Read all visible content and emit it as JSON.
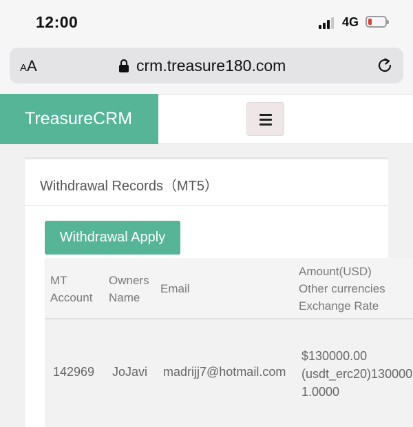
{
  "status_bar": {
    "time": "12:00",
    "network": "4G"
  },
  "browser": {
    "text_size_label_small": "A",
    "text_size_label_large": "A",
    "url": "crm.treasure180.com"
  },
  "app": {
    "brand": "TreasureCRM"
  },
  "page": {
    "title": "Withdrawal Records（MT5）",
    "apply_button": "Withdrawal Apply"
  },
  "table": {
    "headers": {
      "mt_account": [
        "MT",
        "Account"
      ],
      "owners_name": [
        "Owners",
        "Name"
      ],
      "email": "Email",
      "amount": [
        "Amount(USD)",
        "Other currencies",
        "Exchange Rate"
      ]
    },
    "rows": [
      {
        "mt_account": "142969",
        "owners_name": "JoJavi",
        "email": "madrijj7@hotmail.com",
        "amount_usd": "$130000.00",
        "other_currencies": "(usdt_erc20)130000",
        "exchange_rate": "1.0000"
      }
    ]
  }
}
